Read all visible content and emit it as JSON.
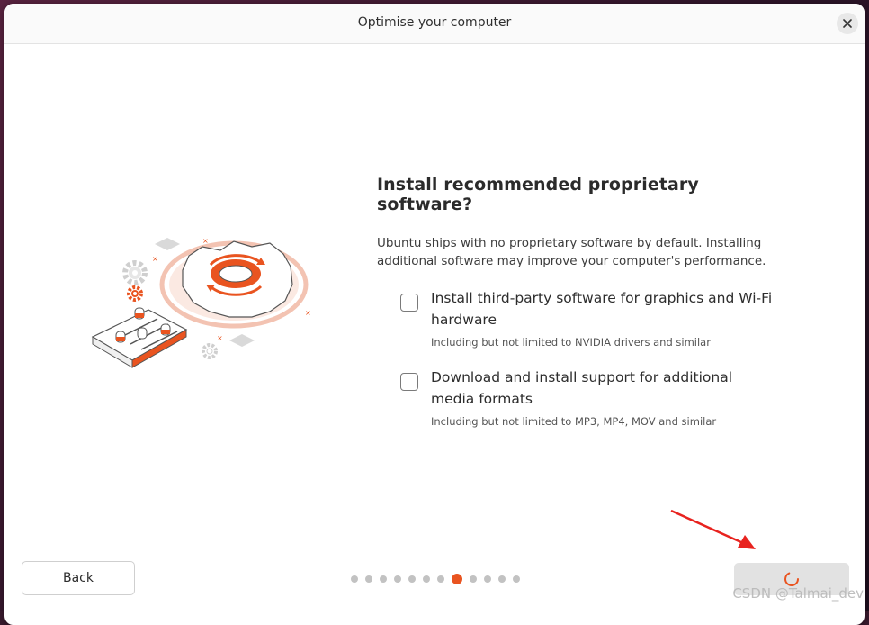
{
  "window": {
    "title": "Optimise your computer",
    "close_icon": "close-icon"
  },
  "main": {
    "heading": "Install recommended proprietary software?",
    "description": "Ubuntu ships with no proprietary software by default. Installing additional software may improve your computer's performance.",
    "options": [
      {
        "label": "Install third-party software for graphics and Wi-Fi hardware",
        "sublabel": "Including but not limited to NVIDIA drivers and similar",
        "checked": false
      },
      {
        "label": "Download and install support for additional media formats",
        "sublabel": "Including but not limited to MP3, MP4, MOV and similar",
        "checked": false
      }
    ],
    "illustration_icon": "gear-settings-illustration"
  },
  "footer": {
    "back_label": "Back",
    "next_state": "loading",
    "page_count": 12,
    "current_page": 8
  },
  "overlay": {
    "watermark": "CSDN @Talmai_dev",
    "annotation_arrow_color": "#e8231f"
  },
  "colors": {
    "accent": "#e95420"
  }
}
